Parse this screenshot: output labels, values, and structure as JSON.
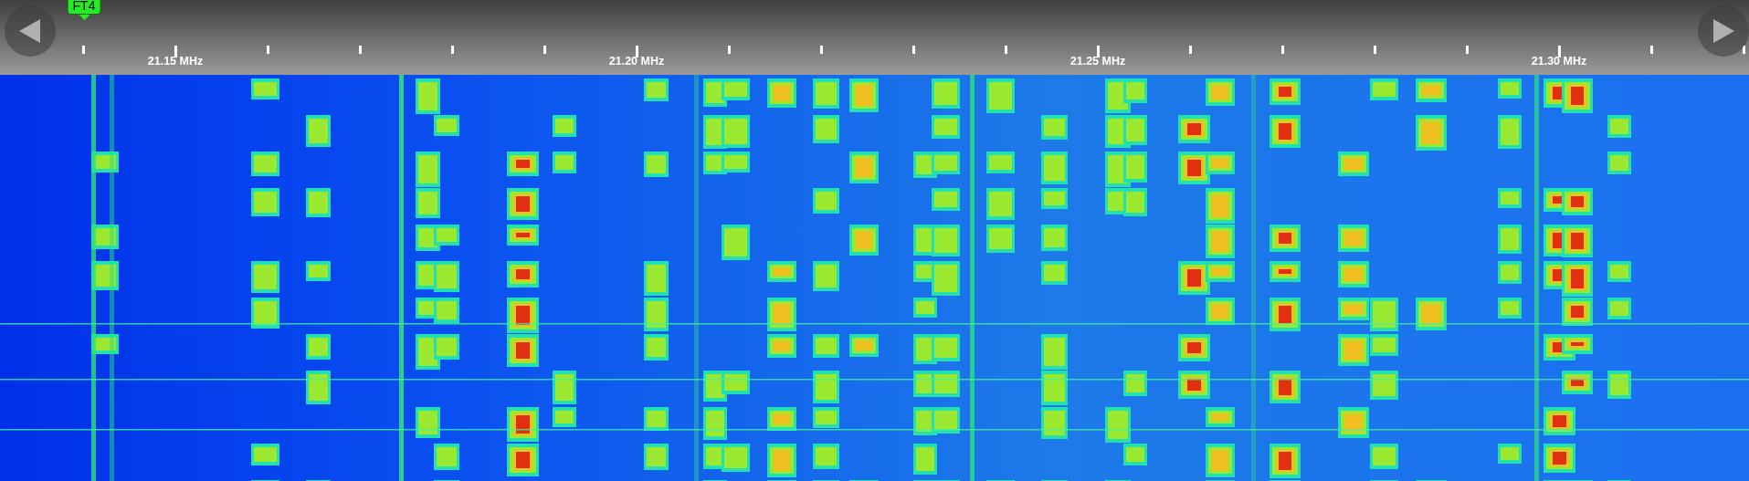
{
  "bookmark": {
    "label": "FT4"
  },
  "scale": {
    "labels": [
      {
        "text": "21.15 MHz"
      },
      {
        "text": "21.20 MHz"
      },
      {
        "text": "21.25 MHz"
      },
      {
        "text": "21.30 MHz"
      }
    ]
  }
}
